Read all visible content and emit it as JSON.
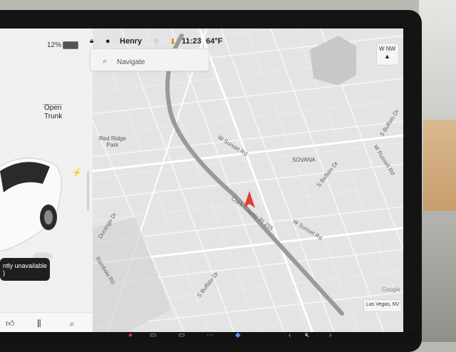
{
  "status_bar": {
    "battery_percent": "12%",
    "user_name": "Henry",
    "time": "11:23",
    "temperature": "64°F"
  },
  "car_panel": {
    "open_trunk_label": "Open\nTrunk",
    "toast_text": "ntly unavailable\n)"
  },
  "map": {
    "search_placeholder": "Navigate",
    "compass_label": "NW",
    "compass_small": "W",
    "location": "Las Vegas, NV",
    "google": "Google",
    "poi": [
      {
        "label": "Red Ridge\nPark"
      },
      {
        "label": "SOVANA"
      }
    ],
    "streets": [
      "W Sunset Rd",
      "Clark County Rt 215",
      "W Sunset Rd",
      "S Buffalo Dr",
      "Durango Dr",
      "Rainbow Rd",
      "S Buffalo Dr",
      "W Russell Rd",
      "S Buffalo Dr"
    ]
  },
  "accent_colors": {
    "nav_arrow": "#e53935",
    "map_bg": "#e3e3e3",
    "road": "#9a9a9a"
  }
}
